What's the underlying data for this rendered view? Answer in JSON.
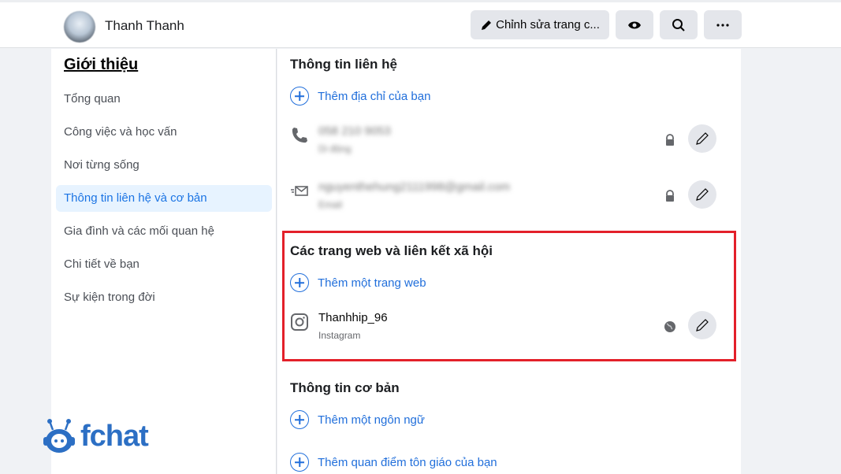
{
  "header": {
    "profile_name": "Thanh Thanh",
    "edit_label": "Chỉnh sửa trang c...",
    "icons": [
      "pencil-icon",
      "eye-icon",
      "search-icon",
      "more-icon"
    ]
  },
  "sidebar": {
    "title": "Giới thiệu",
    "items": [
      {
        "label": "Tổng quan"
      },
      {
        "label": "Công việc và học vấn"
      },
      {
        "label": "Nơi từng sống"
      },
      {
        "label": "Thông tin liên hệ và cơ bản",
        "active": true
      },
      {
        "label": "Gia đình và các mối quan hệ"
      },
      {
        "label": "Chi tiết về bạn"
      },
      {
        "label": "Sự kiện trong đời"
      }
    ]
  },
  "main": {
    "contact": {
      "title": "Thông tin liên hệ",
      "add_label": "Thêm địa chỉ của bạn",
      "phone": {
        "value": "058 210 9053",
        "type": "Di động"
      },
      "email": {
        "value": "nguyenthehung2111998@gmail.com",
        "type": "Email"
      }
    },
    "websites": {
      "title": "Các trang web và liên kết xã hội",
      "add_label": "Thêm một trang web",
      "instagram": {
        "value": "Thanhhip_96",
        "type": "Instagram"
      }
    },
    "basic": {
      "title": "Thông tin cơ bản",
      "add_language": "Thêm một ngôn ngữ",
      "add_religion": "Thêm quan điểm tôn giáo của bạn"
    }
  },
  "watermark": {
    "text": "fchat"
  },
  "colors": {
    "accent": "#216fdb",
    "highlight_box": "#e3202a",
    "active_bg": "#e7f3ff"
  }
}
